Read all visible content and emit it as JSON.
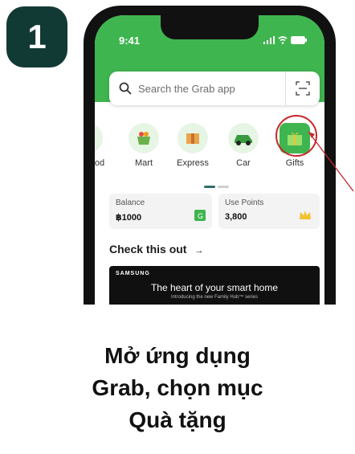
{
  "step": {
    "number": "1"
  },
  "phone": {
    "status_time": "9:41",
    "search": {
      "placeholder": "Search the Grab app"
    },
    "services": [
      {
        "label": "od",
        "icon": "food-icon"
      },
      {
        "label": "Mart",
        "icon": "mart-icon"
      },
      {
        "label": "Express",
        "icon": "express-icon"
      },
      {
        "label": "Car",
        "icon": "car-icon"
      },
      {
        "label": "Gifts",
        "icon": "gift-icon"
      }
    ],
    "balance": {
      "title": "Balance",
      "value": "฿1000"
    },
    "points": {
      "title": "Use Points",
      "value": "3,800"
    },
    "section_title": "Check this out",
    "banner": {
      "brand": "SAMSUNG",
      "headline": "The heart of your smart home",
      "subline": "Introducing the new Family Hub™ series"
    }
  },
  "caption": {
    "line1": "Mở ứng dụng",
    "line2": "Grab, chọn mục",
    "line3": "Quà tặng"
  },
  "colors": {
    "badge": "#123a35",
    "header_green": "#3fb54f",
    "highlight_red": "#c8262b"
  }
}
